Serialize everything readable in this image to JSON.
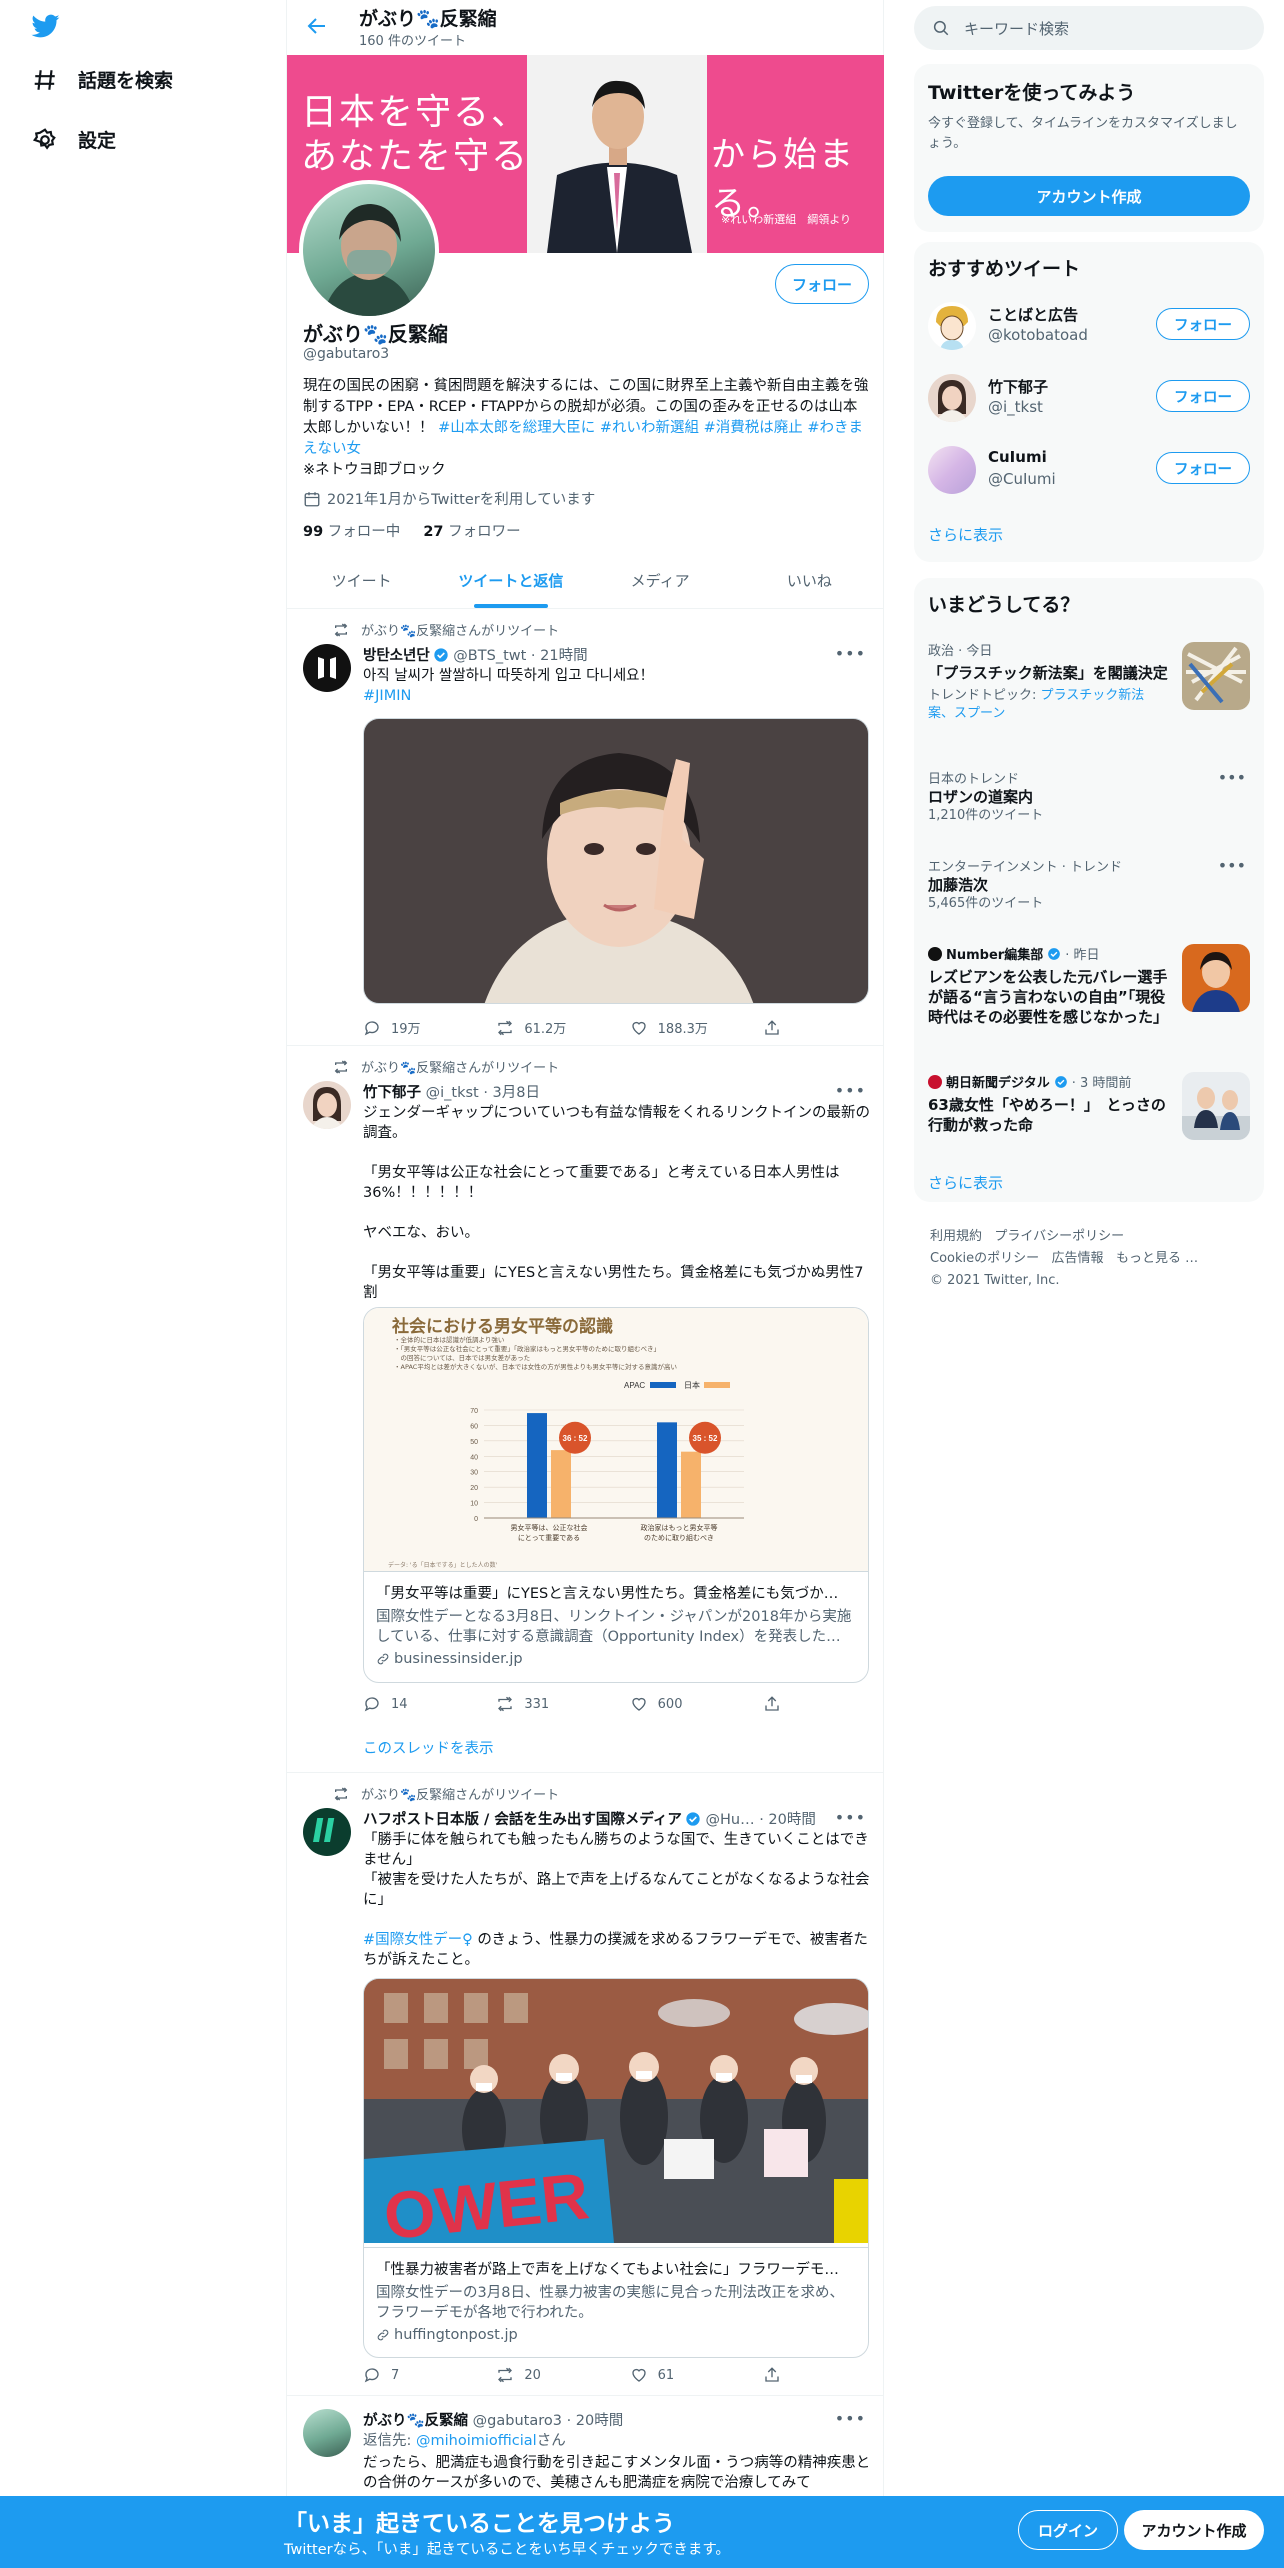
{
  "nav": {
    "items": [
      {
        "label": "話題を検索",
        "icon": "hashtag-icon"
      },
      {
        "label": "設定",
        "icon": "gear-icon"
      }
    ]
  },
  "header": {
    "name": "がぶり🐾反緊縮",
    "tweet_count": "160 件のツイート"
  },
  "banner": {
    "line1": "日本を守る、とは",
    "line2": "あなたを守ること",
    "line_end": "から始まる。",
    "credit": "※れいわ新選組　綱領より"
  },
  "profile": {
    "follow_label": "フォロー",
    "name": "がぶり🐾反緊縮",
    "handle": "@gabutaro3",
    "bio_text": "現在の国民の困窮・貧困問題を解決するには、この国に財界至上主義や新自由主義を強制するTPP・EPA・RCEP・FTAPPからの脱却が必須。この国の歪みを正せるのは山本太郎しかいない！！ ",
    "bio_tags": "#山本太郎を総理大臣に #れいわ新選組 #消費税は廃止 #わきまえない女",
    "bio_note": "※ネトウヨ即ブロック",
    "joined": "2021年1月からTwitterを利用しています",
    "following_count": "99",
    "following_label": " フォロー中",
    "followers_count": "27",
    "followers_label": " フォロワー"
  },
  "tabs": [
    "ツイート",
    "ツイートと返信",
    "メディア",
    "いいね"
  ],
  "tweets": [
    {
      "retweet_label": "がぶり🐾反緊縮さんがリツイート",
      "name": "방탄소년단",
      "meta": " @BTS_twt · 21時間",
      "text": "아직 날씨가 쌀쌀하니 따뜻하게 입고 다니세요！",
      "hashtag": "#JIMIN",
      "replies": "19万",
      "retweets": "61.2万",
      "likes": "188.3万"
    },
    {
      "retweet_label": "がぶり🐾反緊縮さんがリツイート",
      "name": "竹下郁子",
      "meta": " @i_tkst · 3月8日",
      "text1": "ジェンダーギャップについていつも有益な情報をくれるリンクトインの最新の調査。",
      "text2": "「男女平等は公正な社会にとって重要である」と考えている日本人男性は36%！！！！！！",
      "text3": "ヤベエな、おい。",
      "text4": "「男女平等は重要」にYESと言えない男性たち。賃金格差にも気づかぬ男性7割",
      "card_title": "「男女平等は重要」にYESと言えない男性たち。賃金格差にも気づか…",
      "card_desc": "国際女性デーとなる3月8日、リンクトイン・ジャパンが2018年から実施している、仕事に対する意識調査（Opportunity Index）を発表した…",
      "card_domain": "businessinsider.jp",
      "replies": "14",
      "retweets": "331",
      "likes": "600",
      "thread_link": "このスレッドを表示"
    },
    {
      "retweet_label": "がぶり🐾反緊縮さんがリツイート",
      "name": "ハフポスト日本版 / 会話を生み出す国際メディア",
      "meta": " @Hu… · 20時間",
      "text1": "「勝手に体を触られても触ったもん勝ちのような国で、生きていくことはできません」",
      "text2": "「被害を受けた人たちが、路上で声を上げるなんてことがなくなるような社会に」",
      "hashtag": "#国際女性デー♀",
      "text3": " のきょう、性暴力の撲滅を求めるフラワーデモで、被害者たちが訴えたこと。",
      "sign_text": "OWER",
      "card_title": "「性暴力被害者が路上で声を上げなくてもよい社会に」フラワーデモ…",
      "card_desc": "国際女性デーの3月8日、性暴力被害の実態に見合った刑法改正を求め、フラワーデモが各地で行われた。",
      "card_domain": "huffingtonpost.jp",
      "replies": "7",
      "retweets": "20",
      "likes": "61"
    },
    {
      "name": "がぶり🐾反緊縮",
      "meta": " @gabutaro3 · 20時間",
      "reply_to_label": "返信先: ",
      "reply_to": "@mihoimiofficial",
      "reply_to_suffix": "さん",
      "text": "だったら、肥満症も過食行動を引き起こすメンタル面・うつ病等の精神疾患との合併のケースが多いので、美穂さんも肥満症を病院で治療してみて"
    }
  ],
  "chart": {
    "title": "社会における男女平等の認識",
    "notes": [
      "・全体的に日本は認識が低調より強い",
      "・「男女平等は公正な社会にとって重要」「政治家はもっと男女平等のために取り組むべき」",
      "　の回答については、日本では男女差があった",
      "・APAC平均とは差が大きくないが、日本では女性の方が男性よりも男女平等に対する意識が高い"
    ],
    "legend": [
      "APAC",
      "日本"
    ],
    "source": "データ: 'る「日本でする」とした人の数'"
  },
  "chart_data": {
    "type": "bar",
    "title": "社会における男女平等の認識",
    "categories": [
      "男女平等は、公正な社会にとって重要である",
      "政治家はもっと男女平等のために取り組むべき"
    ],
    "series": [
      {
        "name": "APAC",
        "values": [
          68,
          62
        ]
      },
      {
        "name": "日本",
        "values": [
          44,
          43
        ]
      }
    ],
    "annotations": [
      "36 : 52",
      "35 : 52"
    ],
    "ylim": [
      0,
      70
    ],
    "yticks": [
      0,
      10,
      20,
      30,
      40,
      50,
      60,
      70
    ],
    "colors": {
      "APAC": "#1565c0",
      "日本": "#f6b26b"
    },
    "legend_position": "top-right",
    "grid": true
  },
  "right": {
    "search_placeholder": "キーワード検索",
    "signup": {
      "title": "Twitterを使ってみよう",
      "desc": "今すぐ登録して、タイムラインをカスタマイズしましょう。",
      "button": "アカウント作成"
    },
    "recommended": {
      "title": "おすすめツイート",
      "accounts": [
        {
          "name": "ことばと広告",
          "handle": "@kotobatoad",
          "follow": "フォロー"
        },
        {
          "name": "竹下郁子",
          "handle": "@i_tkst",
          "follow": "フォロー"
        },
        {
          "name": "CuIumi",
          "handle": "@CuIumi",
          "follow": "フォロー"
        }
      ],
      "more": "さらに表示"
    },
    "trends": {
      "title": "いまどうしてる？",
      "items": [
        {
          "meta": "政治 · 今日",
          "title": "「プラスチック新法案」を閣議決定",
          "sub_prefix": "トレンドトピック: ",
          "sub_link": "プラスチック新法案、スプーン"
        },
        {
          "meta": "日本のトレンド",
          "title": "ロザンの道案内",
          "sub": "1,210件のツイート"
        },
        {
          "meta": "エンターテインメント · トレンド",
          "title": "加藤浩次",
          "sub": "5,465件のツイート"
        },
        {
          "meta_name": "Number編集部",
          "meta_time": " · 昨日",
          "title": "レズビアンを公表した元バレー選手が語る“言う言わないの自由”「現役時代はその必要性を感じなかった」"
        },
        {
          "meta_name": "朝日新聞デジタル",
          "meta_time": " · 3 時間前",
          "title": "63歳女性「やめろー！」　とっさの行動が救った命"
        }
      ],
      "more": "さらに表示"
    },
    "footer": [
      "利用規約",
      "プライバシーポリシー",
      "Cookieのポリシー",
      "広告情報",
      "もっと見る …",
      "© 2021 Twitter, Inc."
    ]
  },
  "bottom_bar": {
    "title": "「いま」起きていることを見つけよう",
    "sub": "Twitterなら、「いま」起きていることをいち早くチェックできます。",
    "login": "ログイン",
    "signup": "アカウント作成"
  },
  "colors": {
    "accent": "#1d9bf0",
    "banner": "#ee4b8e",
    "text": "#0f1419",
    "secondary": "#536471"
  }
}
